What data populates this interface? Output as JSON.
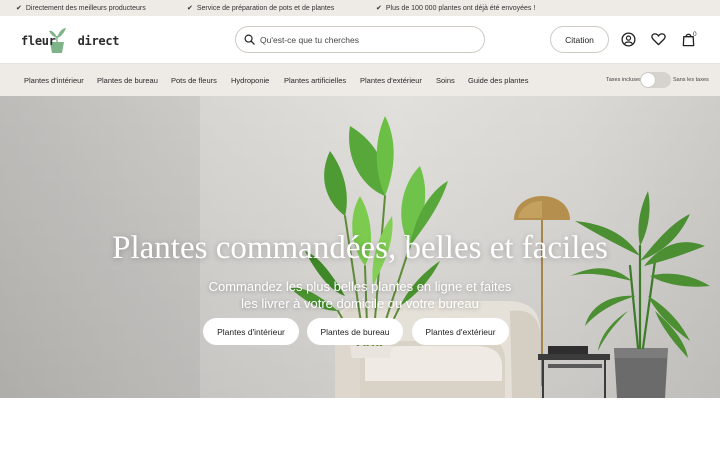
{
  "usp": [
    {
      "text": "Directement des meilleurs producteurs"
    },
    {
      "text": "Service de préparation de pots et de plantes"
    },
    {
      "text": "Plus de 100 000 plantes ont déjà été envoyées !"
    }
  ],
  "header": {
    "logo_left": "fleur",
    "logo_right": "direct",
    "search_placeholder": "Qu'est-ce que tu cherches",
    "citation_label": "Citation",
    "cart_count": "0",
    "icons": [
      "account-icon",
      "heart-icon",
      "cart-icon"
    ]
  },
  "nav": {
    "items": [
      "Plantes d'intérieur",
      "Plantes de bureau",
      "Pots de fleurs",
      "Hydroponie",
      "Plantes artificielles",
      "Plantes d'extérieur",
      "Soins",
      "Guide des plantes"
    ],
    "tax_included": "Taxes incluses",
    "tax_excluded": "Sans les taxes"
  },
  "hero": {
    "title": "Plantes commandées, belles et faciles",
    "subtitle_line1": "Commandez les plus belles plantes en ligne et faites",
    "subtitle_line2": "les livrer à votre domicile ou votre bureau",
    "buttons": [
      "Plantes d'intérieur",
      "Plantes de bureau",
      "Plantes d'extérieur"
    ]
  },
  "colors": {
    "bar_bg": "#eeeae6",
    "logo_green": "#7fb48a",
    "text": "#1f1f1f"
  }
}
